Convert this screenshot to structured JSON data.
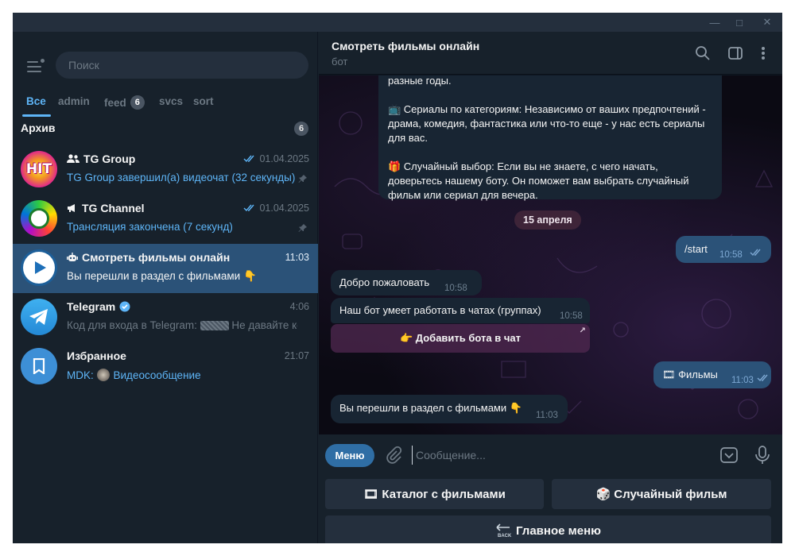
{
  "window": {
    "min": "—",
    "max": "□",
    "close": "✕"
  },
  "sidebar": {
    "search_placeholder": "Поиск",
    "tabs": [
      {
        "label": "Все",
        "active": true
      },
      {
        "label": "admin"
      },
      {
        "label": "feed",
        "badge": "6"
      },
      {
        "label": "svcs"
      },
      {
        "label": "sort"
      }
    ],
    "archive": {
      "label": "Архив",
      "count": "6"
    },
    "chats": [
      {
        "title": "TG Group",
        "title_icon": "group-icon",
        "time": "01.04.2025",
        "read": true,
        "preview": "TG Group завершил(а) видеочат (32 секунды)",
        "preview_blue": true,
        "pinned": true,
        "avatar_text": "HIT"
      },
      {
        "title": "TG Channel",
        "title_icon": "megaphone-icon",
        "time": "01.04.2025",
        "read": true,
        "preview": "Трансляция закончена (7 секунд)",
        "preview_blue": true,
        "pinned": true
      },
      {
        "title": "Смотреть фильмы онлайн",
        "title_icon": "bot-icon",
        "time": "11:03",
        "preview": "Вы перешли в раздел с фильмами 👇",
        "selected": true
      },
      {
        "title": "Telegram",
        "title_icon": "verified-icon",
        "time": "4:06",
        "preview_prefix": "Код для входа в Telegram: ",
        "preview_suffix": " Не давайте код..."
      },
      {
        "title": "Избранное",
        "time": "21:07",
        "preview_prefix": "MDK: ",
        "preview_suffix": "Видеосообщение",
        "preview_blue": true
      }
    ]
  },
  "header": {
    "title": "Смотреть фильмы онлайн",
    "subtitle": "бот"
  },
  "messages": {
    "first_partial_line": "разные годы.",
    "serials": "📺 Сериалы по категориям: Независимо от ваших предпочтений - драма, комедия, фантастика или что-то еще - у нас есть сериалы для вас.",
    "random": "🎁 Случайный выбор: Если вы не знаете, с чего начать, доверьтесь нашему боту. Он поможет вам выбрать случайный фильм или сериал для вечера.",
    "date": "15 апреля",
    "start": {
      "text": "/start",
      "time": "10:58"
    },
    "welcome": {
      "text": "Добро пожаловать",
      "time": "10:58"
    },
    "groups": {
      "text": "Наш бот умеет работать в чатах (группах)",
      "time": "10:58"
    },
    "add_bot_button": "👉 Добавить бота в чат",
    "films": {
      "text": "🎞 Фильмы",
      "time": "11:03"
    },
    "section": {
      "text": "Вы перешли в раздел с фильмами 👇",
      "time": "11:03"
    }
  },
  "composer": {
    "menu_label": "Меню",
    "placeholder": "Сообщение...",
    "keyboard": {
      "catalog": "🎞 Каталог с фильмами",
      "random": "🎲 Случайный фильм",
      "main_menu": "Главное меню"
    }
  }
}
